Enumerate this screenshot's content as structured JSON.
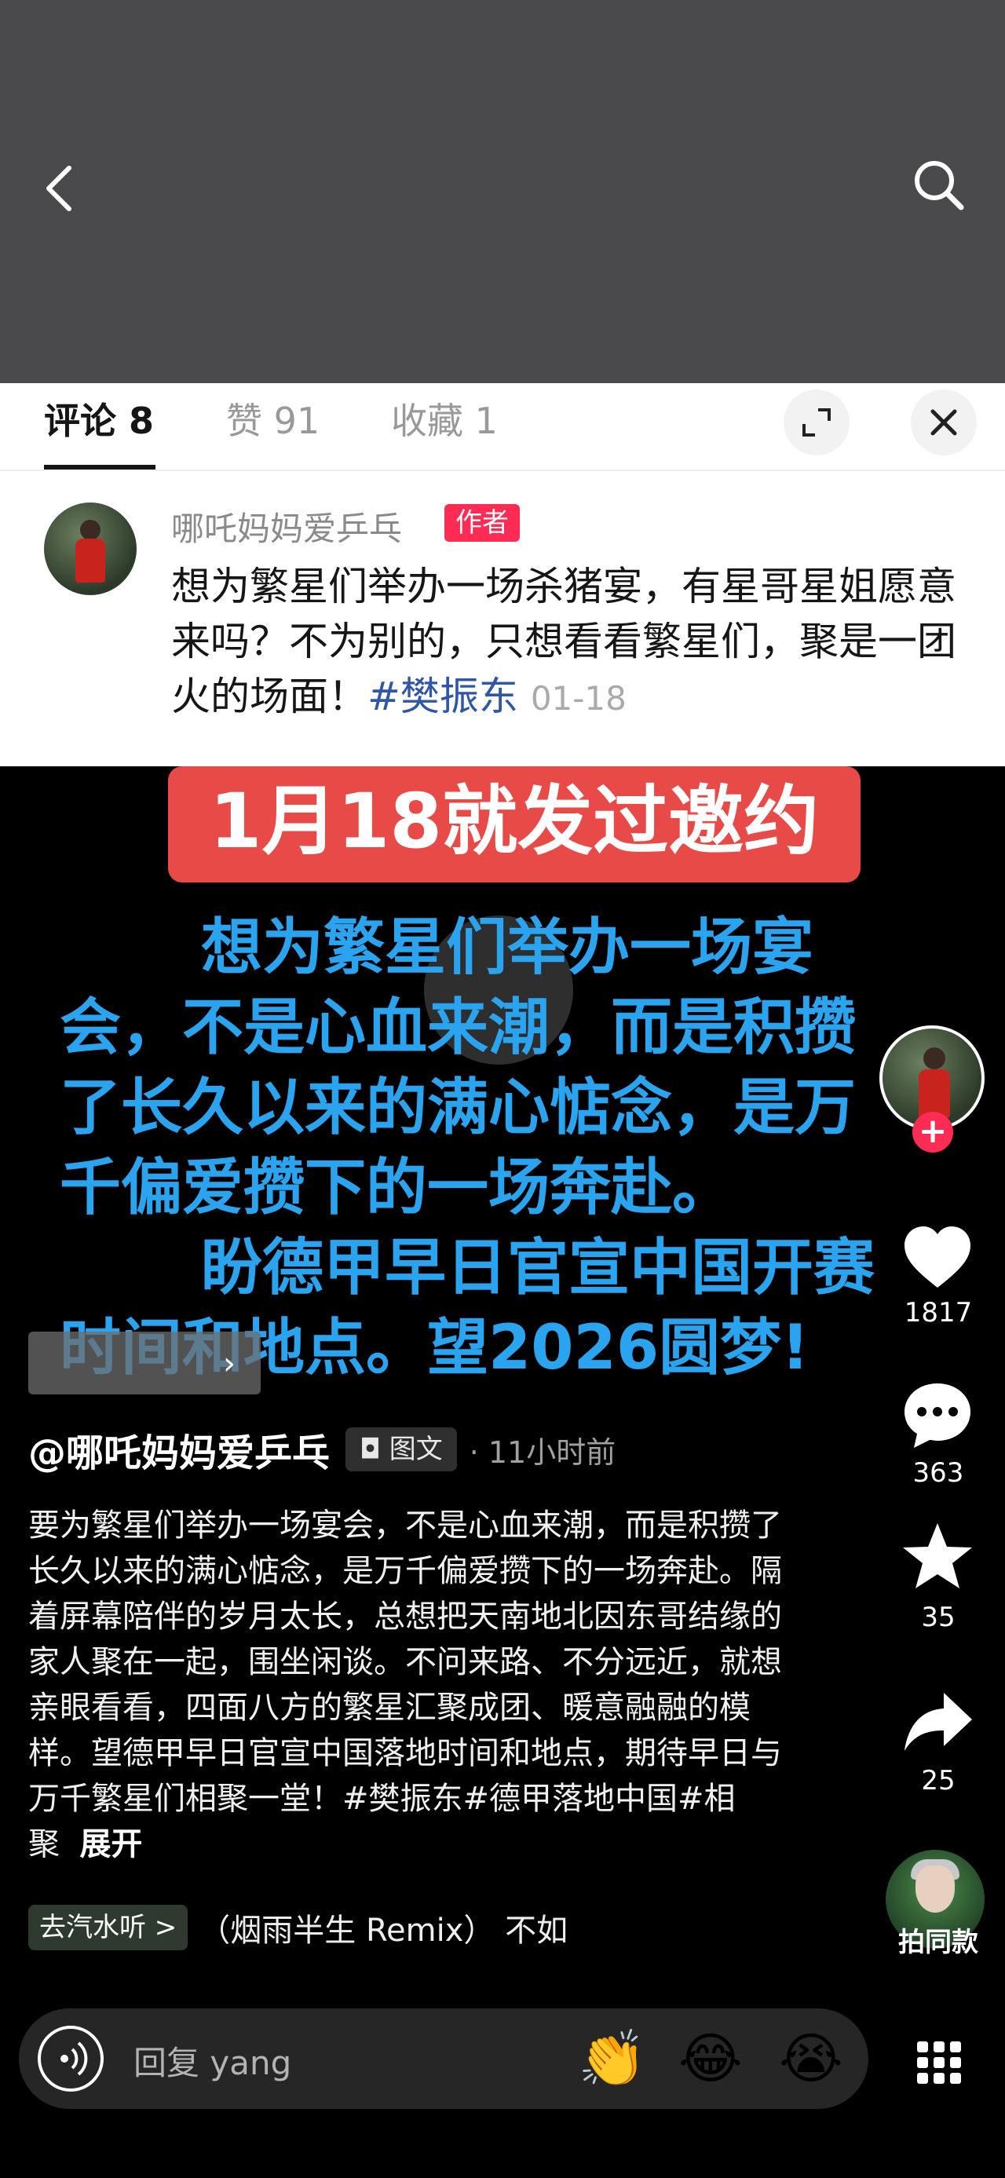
{
  "nav": {
    "back_icon": "back-chevron-icon",
    "search_icon": "search-icon"
  },
  "tabs": [
    {
      "label": "评论 8",
      "active": true
    },
    {
      "label": "赞 91",
      "active": false
    },
    {
      "label": "收藏 1",
      "active": false
    }
  ],
  "sheet_icons": {
    "expand": "expand-icon",
    "close": "close-icon"
  },
  "comment": {
    "author": "哪吒妈妈爱乒乓",
    "badge": "作者",
    "text": "想为繁星们举办一场杀猪宴，有星哥星姐愿意来吗？不为别的，只想看看繁星们，聚是一团火的场面！",
    "tag": "#樊振东",
    "date": "01-18"
  },
  "video": {
    "banner": "1月18就发过邀约",
    "overlay_lines": [
      "想为繁星们举办一场宴",
      "会，不是心血来潮，而是积攒",
      "了长久以来的满心惦念，是万",
      "千偏爱攒下的一场奔赴。",
      "盼德甲早日官宣中国开赛",
      "时间和地点。望2026圆梦!"
    ],
    "author": "@哪吒妈妈爱乒乓",
    "type_badge": "图文",
    "time": "· 11小时前",
    "description": "要为繁星们举办一场宴会，不是心血来潮，而是积攒了长久以来的满心惦念，是万千偏爱攒下的一场奔赴。隔着屏幕陪伴的岁月太长，总想把天南地北因东哥结缘的家人聚在一起，围坐闲谈。不问来路、不分远近，就想亲眼看看，四面八方的繁星汇聚成团、暖意融融的模样。望德甲早日官宣中国落地时间和地点，期待早日与万千繁星们相聚一堂！#樊振东#德甲落地中国#相聚",
    "expand_label": "展开",
    "music_tag": "去汽水听 >",
    "music_name": "（烟雨半生 Remix）    不如"
  },
  "actions": {
    "likes": "1817",
    "comments": "363",
    "favorites": "35",
    "shares": "25",
    "shoot_label": "拍同款"
  },
  "input": {
    "placeholder": "回复 yang",
    "emojis": [
      "👏",
      "😂",
      "😭"
    ]
  }
}
